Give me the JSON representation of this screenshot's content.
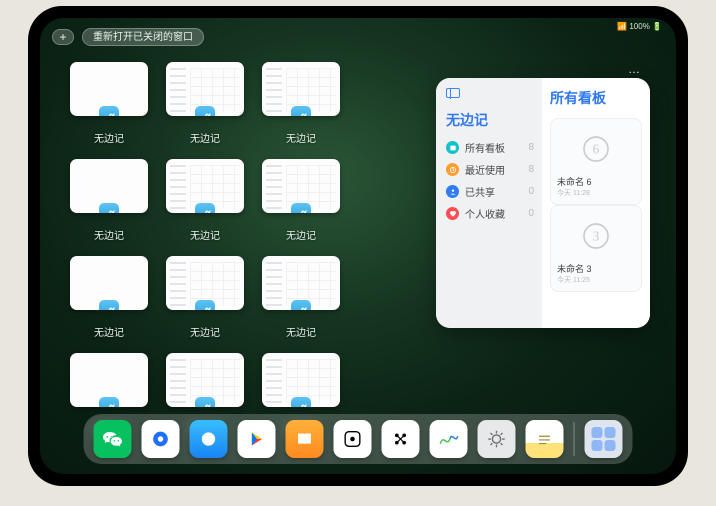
{
  "status": {
    "text": "📶 100% 🔋"
  },
  "topbar": {
    "plus": "+",
    "reopen_label": "重新打开已关闭的窗口"
  },
  "windows": {
    "app_label": "无边记",
    "items": [
      {
        "style": "blank"
      },
      {
        "style": "cal"
      },
      {
        "style": "cal"
      },
      {
        "style": "blank"
      },
      {
        "style": "cal"
      },
      {
        "style": "cal"
      },
      {
        "style": "blank"
      },
      {
        "style": "cal"
      },
      {
        "style": "cal"
      },
      {
        "style": "blank"
      },
      {
        "style": "cal"
      },
      {
        "style": "cal"
      }
    ]
  },
  "preview": {
    "more": "…",
    "left_title": "无边记",
    "right_title": "所有看板",
    "menu": [
      {
        "icon": "teal",
        "label": "所有看板",
        "count": "8"
      },
      {
        "icon": "orange",
        "label": "最近使用",
        "count": "8"
      },
      {
        "icon": "blue",
        "label": "已共享",
        "count": "0"
      },
      {
        "icon": "red",
        "label": "个人收藏",
        "count": "0"
      }
    ],
    "boards": [
      {
        "name": "未命名 6",
        "sub": "今天 11:28",
        "glyph": "6"
      },
      {
        "name": "未命名 3",
        "sub": "今天 11:25",
        "glyph": "3"
      }
    ]
  },
  "dock": {
    "apps": [
      "wechat",
      "qq1",
      "qq2",
      "play",
      "books",
      "dice",
      "dots",
      "freeform",
      "settings",
      "notes"
    ],
    "recent": [
      "folder"
    ]
  }
}
